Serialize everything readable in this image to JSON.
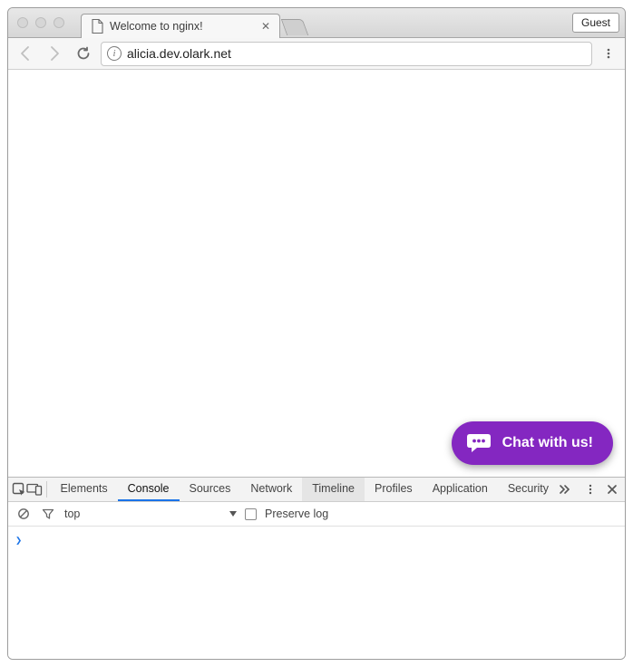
{
  "window": {
    "tab_title": "Welcome to nginx!",
    "guest_label": "Guest",
    "url": "alicia.dev.olark.net"
  },
  "chat": {
    "label": "Chat with us!",
    "bg": "#8427c1"
  },
  "devtools": {
    "tabs": {
      "elements": "Elements",
      "console": "Console",
      "sources": "Sources",
      "network": "Network",
      "timeline": "Timeline",
      "profiles": "Profiles",
      "application": "Application",
      "security": "Security"
    },
    "context": "top",
    "preserve_log_label": "Preserve log",
    "prompt": "❯"
  }
}
